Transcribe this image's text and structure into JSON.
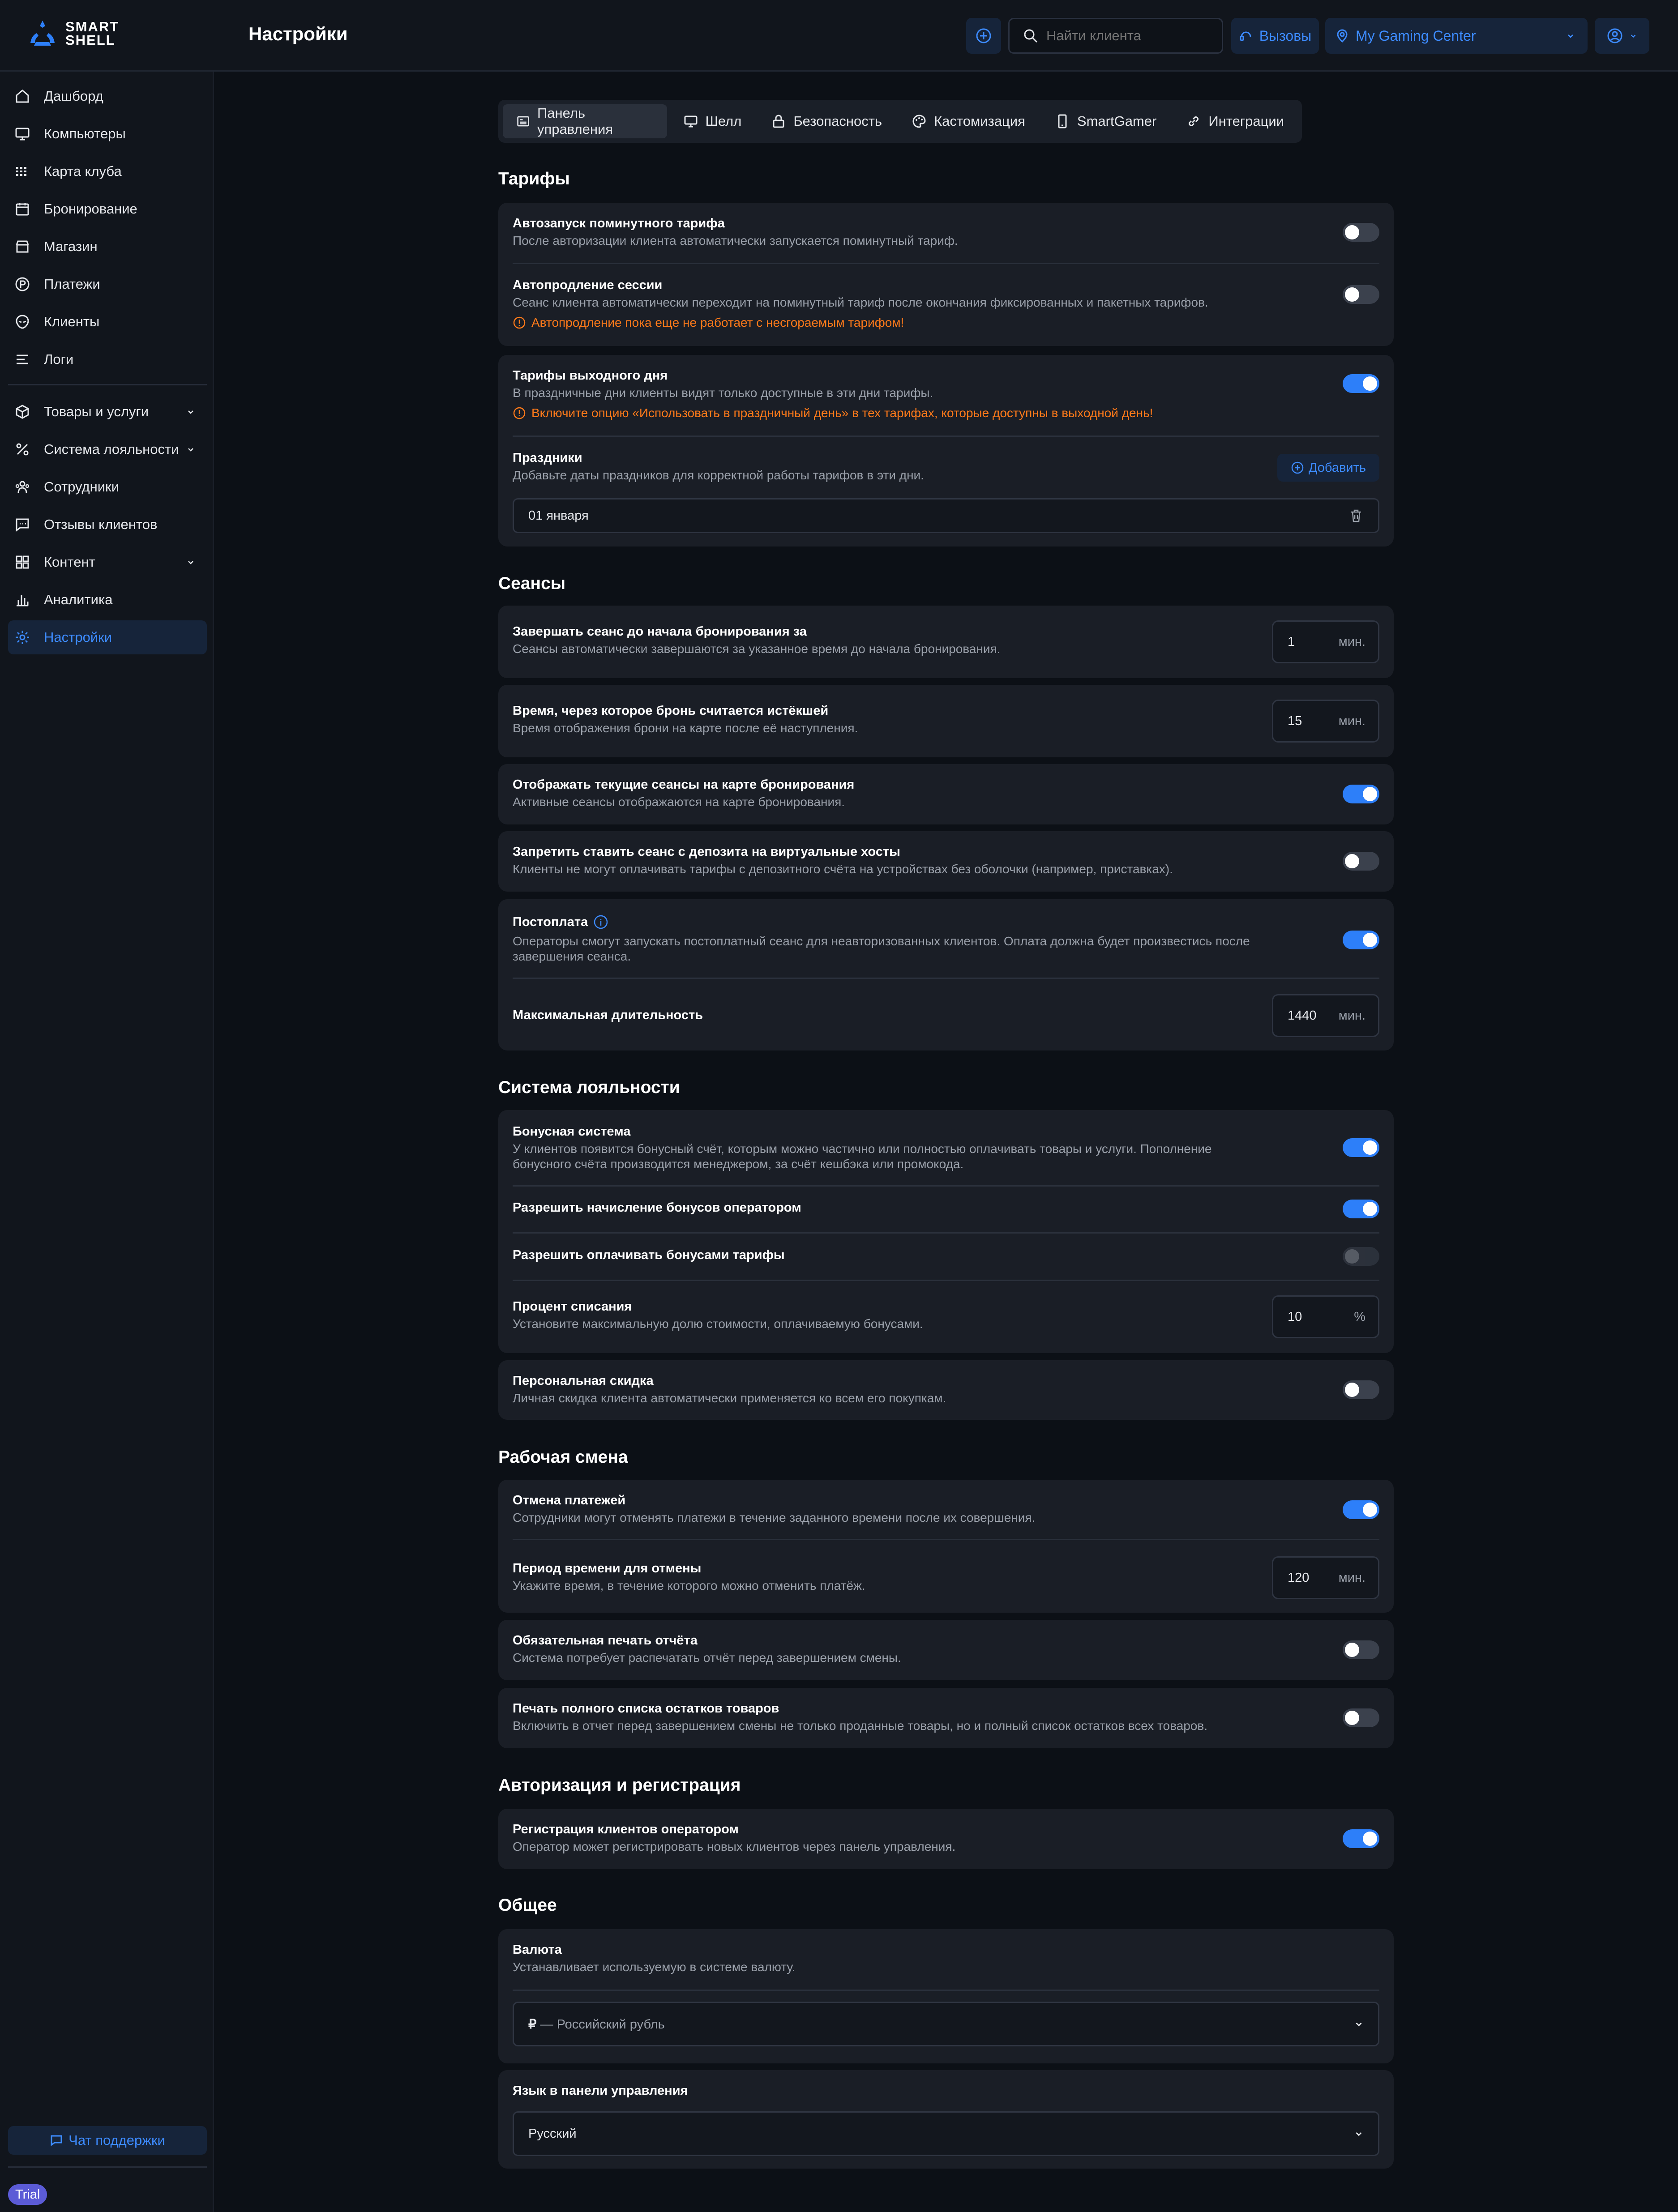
{
  "app": {
    "logo_line1": "SMART",
    "logo_line2": "SHELL",
    "page_title": "Настройки"
  },
  "header": {
    "search_placeholder": "Найти клиента",
    "calls_label": "Вызовы",
    "club_name": "My Gaming Center"
  },
  "sidebar": {
    "items": [
      "Дашборд",
      "Компьютеры",
      "Карта клуба",
      "Бронирование",
      "Магазин",
      "Платежи",
      "Клиенты",
      "Логи"
    ],
    "items2": [
      "Товары и услуги",
      "Система лояльности",
      "Сотрудники",
      "Отзывы клиентов",
      "Контент",
      "Аналитика",
      "Настройки"
    ],
    "support": "Чат поддержки",
    "trial": "Trial"
  },
  "tabs": [
    "Панель управления",
    "Шелл",
    "Безопасность",
    "Кастомизация",
    "SmartGamer",
    "Интеграции"
  ],
  "tariffs": {
    "title": "Тарифы",
    "r1_title": "Автозапуск поминутного тарифа",
    "r1_desc": "После авторизации клиента автоматически запускается поминутный тариф.",
    "r2_title": "Автопродление сессии",
    "r2_desc": "Сеанс клиента автоматически переходит на поминутный тариф после окончания фиксированных и пакетных тарифов.",
    "r2_warn": "Автопродление пока еще не работает с несгораемым тарифом!",
    "r3_title": "Тарифы выходного дня",
    "r3_desc": "В праздничные дни клиенты видят только доступные в эти дни тарифы.",
    "r3_warn": "Включите опцию «Использовать в праздничный день» в тех тарифах, которые доступны в выходной день!",
    "holidays_title": "Праздники",
    "holidays_desc": "Добавьте даты праздников для корректной работы тарифов в эти дни.",
    "add_label": "Добавить",
    "holiday_date": "01 января"
  },
  "sessions": {
    "title": "Сеансы",
    "r1_title": "Завершать сеанс до начала бронирования за",
    "r1_desc": "Сеансы автоматически завершаются за указанное время до начала бронирования.",
    "r1_value": "1",
    "r2_title": "Время, через которое бронь считается истёкшей",
    "r2_desc": "Время отображения брони на карте после её наступления.",
    "r2_value": "15",
    "r3_title": "Отображать текущие сеансы на карте бронирования",
    "r3_desc": "Активные сеансы отображаются на карте бронирования.",
    "r4_title": "Запретить ставить сеанс с депозита на виртуальные хосты",
    "r4_desc": "Клиенты не могут оплачивать тарифы с депозитного счёта на устройствах без оболочки (например, приставках).",
    "r5_title": "Постоплата",
    "r5_desc1": "Операторы смогут запускать постоплатный сеанс для неавторизованных клиентов. Оплата должна будет произвестись после",
    "r5_desc2": "завершения сеанса.",
    "r6_title": "Максимальная длительность",
    "r6_value": "1440",
    "unit_min": "мин."
  },
  "loyalty": {
    "title": "Система лояльности",
    "r1_title": "Бонусная система",
    "r1_desc1": "У клиентов появится бонусный счёт, которым можно частично или полностью оплачивать товары и услуги. Пополнение",
    "r1_desc2": "бонусного счёта производится менеджером, за счёт кешбэка или промокода.",
    "r2_title": "Разрешить начисление бонусов оператором",
    "r3_title": "Разрешить оплачивать бонусами тарифы",
    "r4_title": "Процент списания",
    "r4_desc": "Установите максимальную долю стоимости, оплачиваемую бонусами.",
    "r4_value": "10",
    "r4_unit": "%",
    "r5_title": "Персональная скидка",
    "r5_desc": "Личная скидка клиента автоматически применяется ко всем его покупкам."
  },
  "shift": {
    "title": "Рабочая смена",
    "r1_title": "Отмена платежей",
    "r1_desc": "Сотрудники могут отменять платежи в течение заданного времени после их совершения.",
    "r2_title": "Период времени для отмены",
    "r2_desc": "Укажите время, в течение которого можно отменить платёж.",
    "r2_value": "120",
    "r3_title": "Обязательная печать отчёта",
    "r3_desc": "Система потребует распечатать отчёт перед завершением смены.",
    "r4_title": "Печать полного списка остатков товаров",
    "r4_desc": "Включить в отчет перед завершением смены не только проданные товары, но и полный список остатков всех товаров."
  },
  "auth": {
    "title": "Авторизация и регистрация",
    "r1_title": "Регистрация клиентов оператором",
    "r1_desc": "Оператор может регистрировать новых клиентов через панель управления."
  },
  "general": {
    "title": "Общее",
    "currency_title": "Валюта",
    "currency_desc": "Устанавливает используемую в системе валюту.",
    "currency_symbol": "₽",
    "currency_value": "— Российский рубль",
    "lang_title": "Язык в панели управления",
    "lang_value": "Русский"
  },
  "colors": {
    "accent": "#2d7ff9",
    "warning": "#ff7a1a",
    "background": "#0c1016",
    "card": "#1a1e26"
  }
}
